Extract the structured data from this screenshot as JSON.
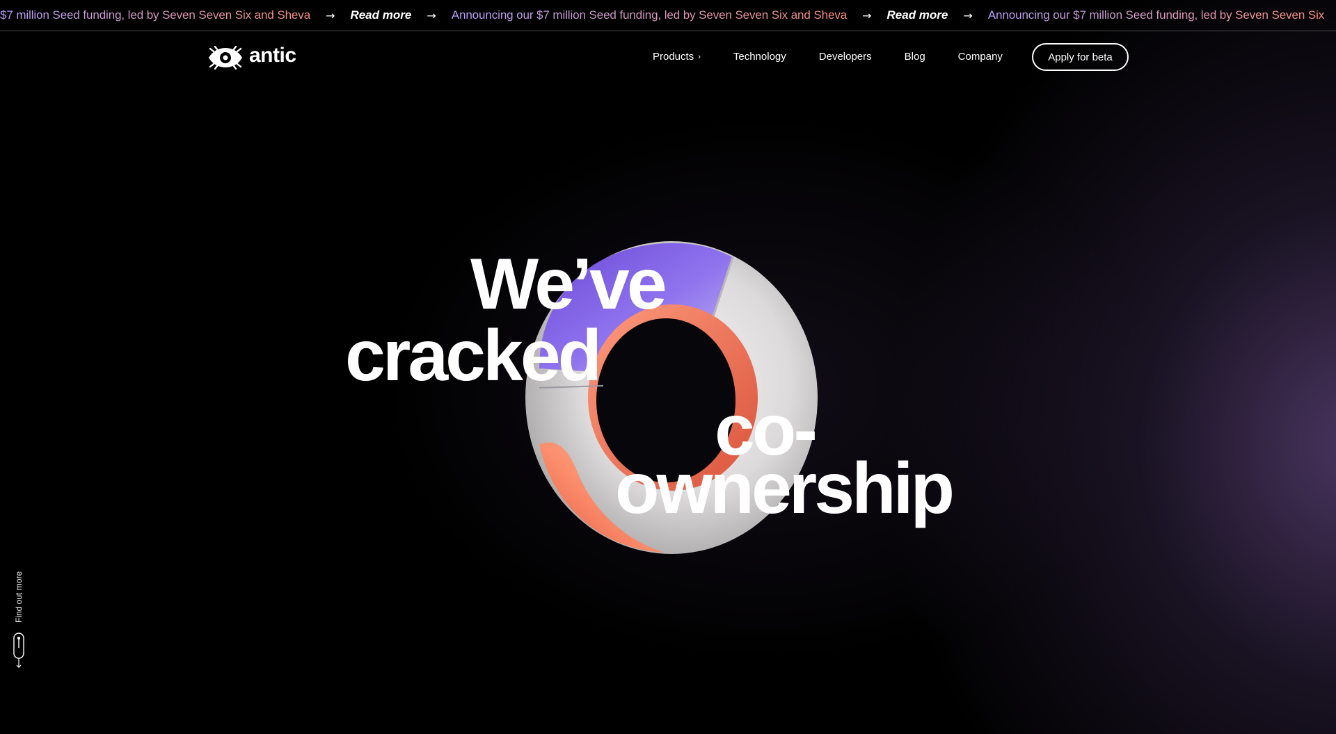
{
  "announcement": {
    "leading_fragment": "$7 million Seed funding, led by Seven Seven Six and Sheva",
    "text": "Announcing our $7 million Seed funding, led by Seven Seven Six and Sheva",
    "trailing_fragment": "Announcing our $7 million Seed funding, led by Seven Seven Six",
    "link_label": "Read more",
    "arrow": "→",
    "gradient_colors": [
      "#b7a1ff",
      "#d59bc4",
      "#ff8f78"
    ]
  },
  "header": {
    "logo_text": "antic",
    "nav": [
      {
        "label": "Products",
        "has_submenu": true,
        "chevron": "›"
      },
      {
        "label": "Technology"
      },
      {
        "label": "Developers"
      },
      {
        "label": "Blog"
      },
      {
        "label": "Company"
      }
    ],
    "cta_label": "Apply for beta"
  },
  "hero": {
    "headline_lines": [
      "We’ve",
      "cracked",
      "co-",
      "ownership"
    ],
    "ring_colors": {
      "purple": "#7b5ce0",
      "coral": "#ff7a5c",
      "stone": "#e8e6e6"
    }
  },
  "scroll_hint": {
    "label": "Find out more"
  },
  "colors": {
    "background": "#000000",
    "glow": "#563e70",
    "text": "#ffffff",
    "divider": "#4a4a4a"
  }
}
